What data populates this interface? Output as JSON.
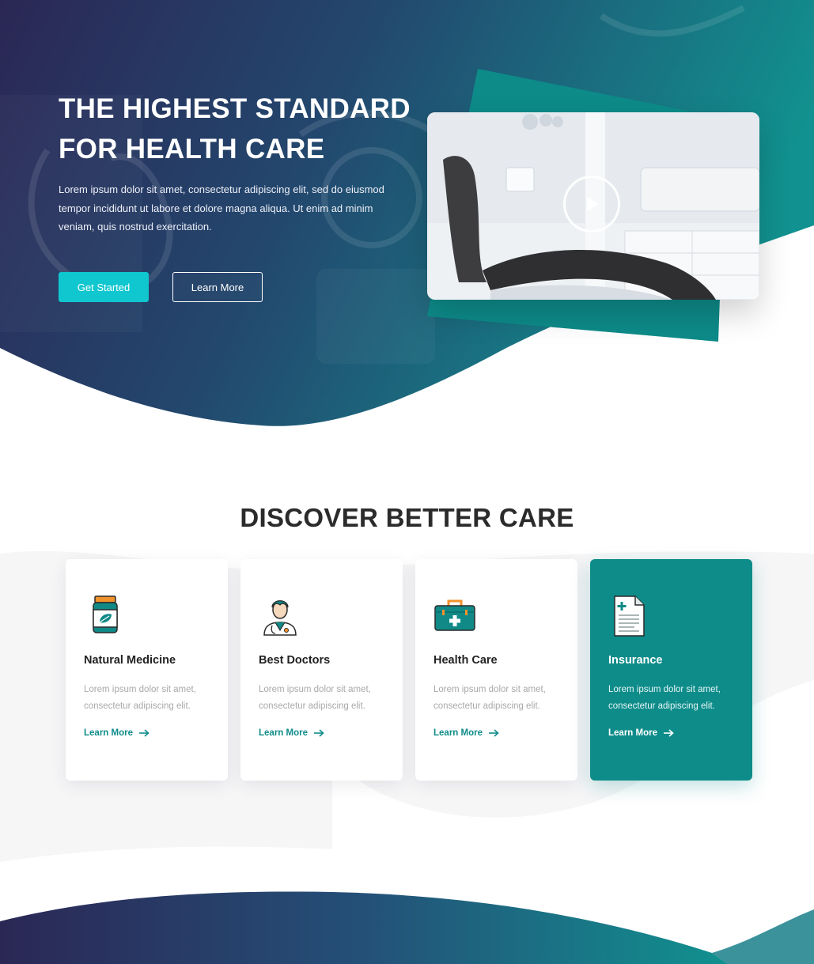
{
  "hero": {
    "title_line1": "THE HIGHEST STANDARD",
    "title_line2": "FOR HEALTH CARE",
    "description": "Lorem ipsum dolor sit amet, consectetur adipiscing elit, sed do eiusmod tempor incididunt ut labore et dolore magna aliqua. Ut enim ad minim veniam, quis nostrud exercitation.",
    "primary_button": "Get Started",
    "secondary_button": "Learn More",
    "media": {
      "type": "video-thumbnail",
      "icon": "play-icon"
    }
  },
  "discover": {
    "title": "DISCOVER BETTER CARE",
    "cards": [
      {
        "icon": "medicine-bottle-icon",
        "title": "Natural Medicine",
        "text": "Lorem ipsum dolor sit amet, consectetur adipiscing elit.",
        "link": "Learn More"
      },
      {
        "icon": "doctor-icon",
        "title": "Best Doctors",
        "text": "Lorem ipsum dolor sit amet, consectetur adipiscing elit.",
        "link": "Learn More"
      },
      {
        "icon": "medical-kit-icon",
        "title": "Health Care",
        "text": "Lorem ipsum dolor sit amet, consectetur adipiscing elit.",
        "link": "Learn More"
      },
      {
        "icon": "document-icon",
        "title": "Insurance",
        "text": "Lorem ipsum dolor sit amet, consectetur adipiscing elit.",
        "link": "Learn More",
        "featured": true
      }
    ]
  },
  "colors": {
    "accent_teal": "#0e8c8a",
    "button_cyan": "#10c6cf",
    "gradient_start": "#2b2755",
    "gradient_end": "#11918f"
  }
}
